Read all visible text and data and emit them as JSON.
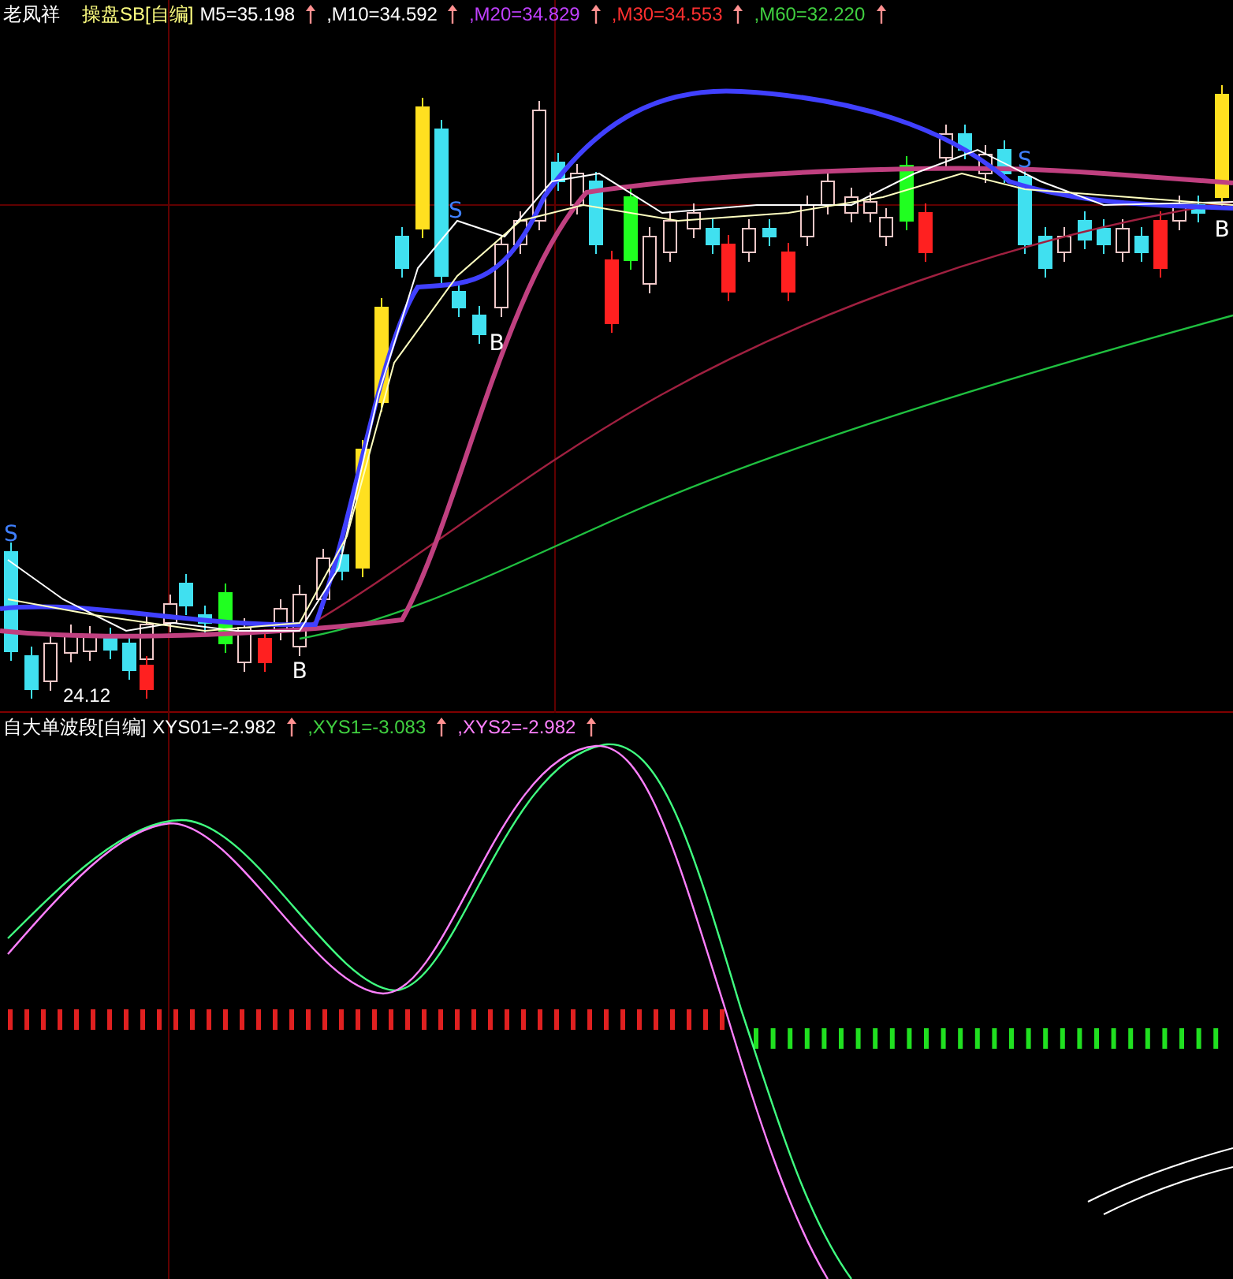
{
  "main_panel": {
    "stock_name": "老凤祥",
    "indicator": "操盘SB[自编]",
    "values": [
      {
        "text": "M5=35.198",
        "color": "#ffffff"
      },
      {
        "text": ",M10=34.592",
        "color": "#ffffff"
      },
      {
        "text": ",M20=34.829",
        "color": "#c040ff"
      },
      {
        "text": ",M30=34.553",
        "color": "#ff3030"
      },
      {
        "text": ",M60=32.220",
        "color": "#40d040"
      }
    ],
    "signals": [
      {
        "kind": "sell",
        "label": "S"
      },
      {
        "kind": "sell",
        "label": "S"
      },
      {
        "kind": "sell",
        "label": "S"
      },
      {
        "kind": "buy",
        "label": "B"
      },
      {
        "kind": "buy",
        "label": "B"
      },
      {
        "kind": "buy",
        "label": "B"
      }
    ],
    "price_label": "24.12"
  },
  "sub_panel": {
    "indicator": "自大单波段[自编]",
    "values": [
      {
        "text": "XYS01=-2.982",
        "color": "#ffffff"
      },
      {
        "text": ",XYS1=-3.083",
        "color": "#40d040"
      },
      {
        "text": ",XYS2=-2.982",
        "color": "#ff80ff"
      }
    ]
  }
}
